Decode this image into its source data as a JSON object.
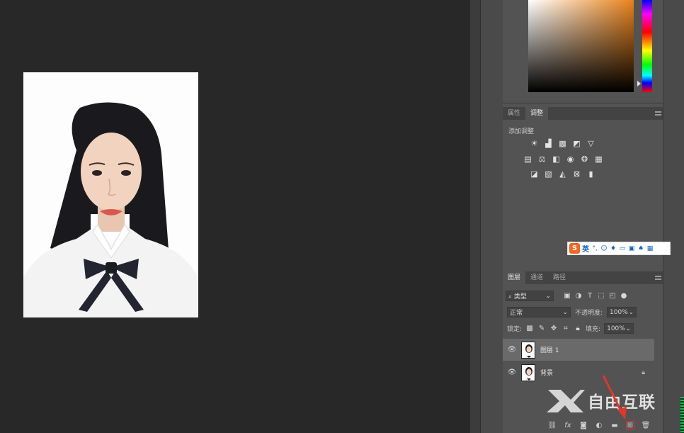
{
  "properties_panel": {
    "tabs": [
      "属性",
      "调整"
    ],
    "active_tab": "调整",
    "section_title": "添加调整",
    "row1_icons": [
      "brightness-contrast-icon",
      "levels-icon",
      "curves-icon",
      "exposure-icon",
      "vibrance-icon"
    ],
    "row2_icons": [
      "hue-saturation-icon",
      "color-balance-icon",
      "black-white-icon",
      "photo-filter-icon",
      "channel-mixer-icon",
      "color-lookup-icon"
    ],
    "row3_icons": [
      "invert-icon",
      "posterize-icon",
      "threshold-icon",
      "selective-color-icon",
      "gradient-map-icon"
    ]
  },
  "ime_bar": {
    "logo": "S",
    "mode": "英",
    "icons": [
      "punctuation-icon",
      "emoji-icon",
      "microphone-icon",
      "keyboard-icon",
      "toolbox-icon",
      "skin-icon",
      "grid-icon"
    ]
  },
  "layers_panel": {
    "tabs": [
      "图层",
      "通道",
      "路径"
    ],
    "active_tab": "图层",
    "filter_kind": "类型",
    "blend_mode": "正常",
    "opacity_label": "不透明度:",
    "opacity_value": "100%",
    "lock_label": "锁定:",
    "fill_label": "填充:",
    "fill_value": "100%",
    "layers": [
      {
        "name": "图层 1",
        "visible": true,
        "selected": true,
        "locked": false
      },
      {
        "name": "背景",
        "visible": true,
        "selected": false,
        "locked": true
      }
    ],
    "bottom_icons": [
      "link-icon",
      "fx-icon",
      "mask-icon",
      "adjustment-icon",
      "folder-icon",
      "new-layer-icon",
      "trash-icon"
    ],
    "fx_label": "fx"
  },
  "watermark": {
    "text": "自由互联"
  },
  "colors": {
    "accent_arrow": "#e0362c",
    "panel_bg": "#535353",
    "canvas_bg": "#282828"
  }
}
